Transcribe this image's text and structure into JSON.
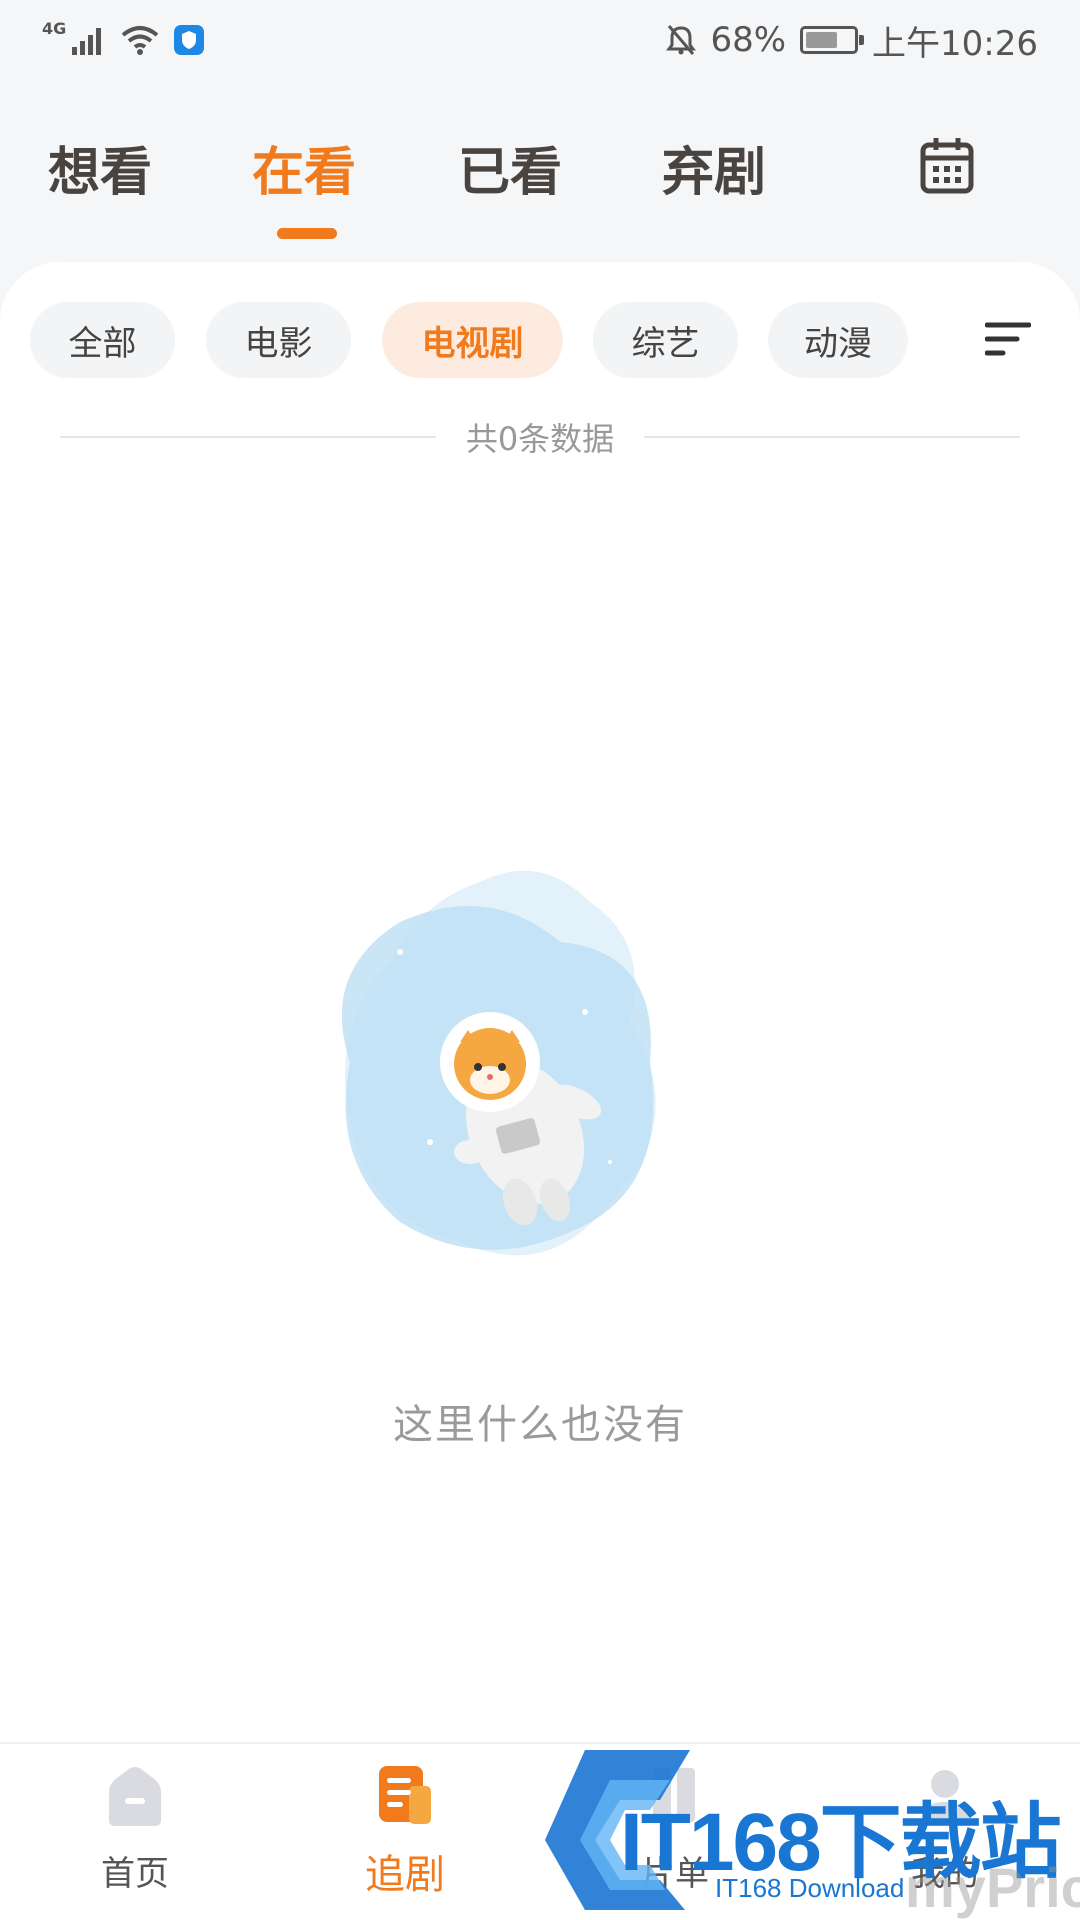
{
  "status_bar": {
    "network": "4G",
    "battery": "68%",
    "battery_level": 0.68,
    "time": "上午10:26"
  },
  "top_tabs": [
    {
      "label": "想看",
      "active": false
    },
    {
      "label": "在看",
      "active": true
    },
    {
      "label": "已看",
      "active": false
    },
    {
      "label": "弃剧",
      "active": false
    }
  ],
  "filters": [
    {
      "label": "全部",
      "active": false
    },
    {
      "label": "电影",
      "active": false
    },
    {
      "label": "电视剧",
      "active": true
    },
    {
      "label": "综艺",
      "active": false
    },
    {
      "label": "动漫",
      "active": false
    }
  ],
  "count_text": "共0条数据",
  "empty_text": "这里什么也没有",
  "bottom_nav": [
    {
      "label": "首页",
      "icon": "home-icon",
      "active": false
    },
    {
      "label": "追剧",
      "icon": "tracking-icon",
      "active": true
    },
    {
      "label": "片单",
      "icon": "list-icon",
      "active": false
    },
    {
      "label": "我的",
      "icon": "profile-icon",
      "active": false
    }
  ],
  "watermark": {
    "main": "IT168下载站",
    "sub": "IT168 Download",
    "brand": "myPrice"
  },
  "colors": {
    "accent": "#f07a1c",
    "chip_active_bg": "#fdebe0",
    "page_bg": "#f5f6f8"
  }
}
